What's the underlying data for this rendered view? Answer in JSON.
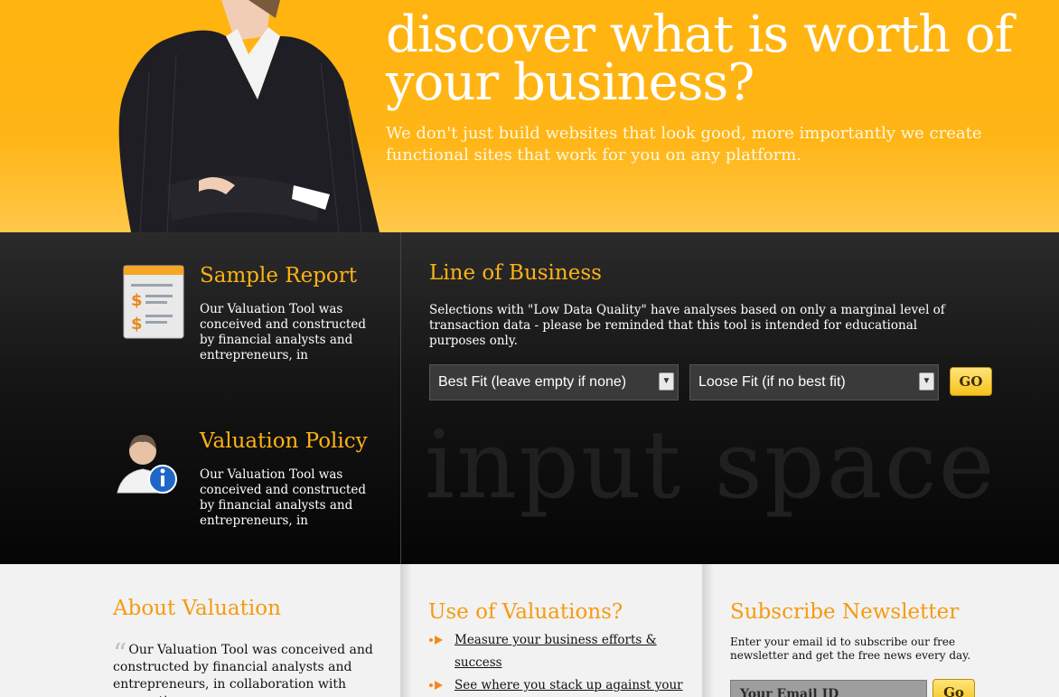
{
  "hero": {
    "title": "discover what is worth of your business?",
    "subtitle": "We don't just build websites that look good, more importantly we create functional sites that work for you on any platform."
  },
  "sample_report": {
    "title": "Sample Report",
    "text": "Our Valuation Tool was conceived and constructed by financial analysts and entrepreneurs, in",
    "icon": "report-document-icon"
  },
  "valuation_policy": {
    "title": "Valuation Policy",
    "text": "Our Valuation Tool was conceived and constructed by financial analysts and entrepreneurs, in",
    "icon": "user-info-icon"
  },
  "line_of_business": {
    "title": "Line of Business",
    "text": "Selections with \"Low Data Quality\" have analyses based on only a marginal level of transaction data - please be reminded that this tool is intended for educational purposes only.",
    "best_fit": "Best Fit (leave empty if none)",
    "loose_fit": "Loose Fit (if no best fit)",
    "go_label": "GO",
    "watermark": "input space"
  },
  "about": {
    "title": "About Valuation",
    "text": "Our Valuation Tool was conceived and constructed by financial analysts and entrepreneurs, in collaboration with accounting"
  },
  "use": {
    "title": "Use of Valuations?",
    "items": [
      "Measure your business efforts & success",
      "See where you stack up against your competition"
    ]
  },
  "newsletter": {
    "title": "Subscribe Newsletter",
    "text": "Enter your email id to subscribe our free newsletter and get the free news every day.",
    "email_placeholder": "Your Email ID",
    "go_label": "Go"
  },
  "colors": {
    "accent": "#ffb315",
    "hero_bg": "#ffb40f",
    "bottom_heading": "#f59b12"
  }
}
